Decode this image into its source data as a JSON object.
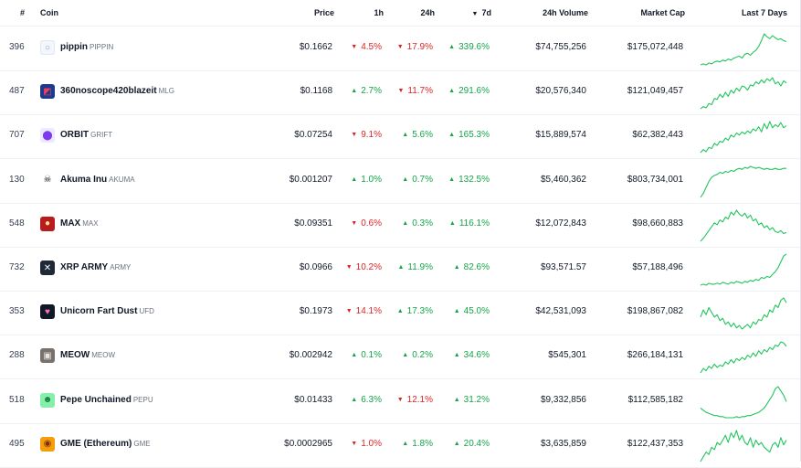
{
  "header": {
    "rank": "#",
    "coin": "Coin",
    "price": "Price",
    "h1": "1h",
    "h24": "24h",
    "d7": "7d",
    "volume": "24h Volume",
    "market_cap": "Market Cap",
    "last7": "Last 7 Days",
    "sort_indicator": "▼"
  },
  "colors": {
    "positive": "#16a34a",
    "negative": "#dc2626",
    "sparkline": "#22c55e"
  },
  "rows": [
    {
      "rank": "396",
      "name": "pippin",
      "symbol": "PIPPIN",
      "icon": "pippin-icon",
      "price": "$0.1662",
      "h1": "4.5%",
      "h1_dir": "down",
      "h24": "17.9%",
      "h24_dir": "down",
      "d7": "339.6%",
      "d7_dir": "up",
      "volume": "$74,755,256",
      "market_cap": "$175,072,448",
      "spark": [
        3,
        4,
        3,
        5,
        4,
        6,
        7,
        6,
        8,
        7,
        9,
        8,
        10,
        11,
        12,
        10,
        14,
        15,
        13,
        16,
        18,
        22,
        28,
        35,
        32,
        30,
        33,
        31,
        29,
        30,
        28,
        27
      ]
    },
    {
      "rank": "487",
      "name": "360noscope420blazeit",
      "symbol": "MLG",
      "icon": "mlg-icon",
      "price": "$0.1168",
      "h1": "2.7%",
      "h1_dir": "up",
      "h24": "11.7%",
      "h24_dir": "down",
      "d7": "291.6%",
      "d7_dir": "up",
      "volume": "$20,576,340",
      "market_cap": "$121,049,457",
      "spark": [
        4,
        6,
        5,
        9,
        8,
        14,
        13,
        18,
        15,
        20,
        16,
        22,
        19,
        24,
        21,
        26,
        25,
        22,
        27,
        26,
        30,
        28,
        32,
        29,
        33,
        31,
        34,
        28,
        30,
        26,
        31,
        29
      ]
    },
    {
      "rank": "707",
      "name": "ORBIT",
      "symbol": "GRIFT",
      "icon": "orbit-icon",
      "price": "$0.07254",
      "h1": "9.1%",
      "h1_dir": "down",
      "h24": "5.6%",
      "h24_dir": "up",
      "d7": "165.3%",
      "d7_dir": "up",
      "volume": "$15,889,574",
      "market_cap": "$62,382,443",
      "spark": [
        5,
        8,
        6,
        10,
        9,
        14,
        12,
        16,
        15,
        19,
        17,
        22,
        20,
        24,
        22,
        25,
        23,
        26,
        24,
        28,
        26,
        30,
        25,
        33,
        28,
        35,
        29,
        32,
        30,
        34,
        29,
        31
      ]
    },
    {
      "rank": "130",
      "name": "Akuma Inu",
      "symbol": "AKUMA",
      "icon": "akuma-icon",
      "price": "$0.001207",
      "h1": "1.0%",
      "h1_dir": "up",
      "h24": "0.7%",
      "h24_dir": "up",
      "d7": "132.5%",
      "d7_dir": "up",
      "volume": "$5,460,362",
      "market_cap": "$803,734,001",
      "spark": [
        2,
        6,
        12,
        18,
        22,
        24,
        25,
        27,
        26,
        28,
        27,
        29,
        28,
        30,
        31,
        30,
        32,
        31,
        33,
        32,
        31,
        32,
        31,
        30,
        31,
        30,
        30,
        31,
        30,
        30,
        31,
        31
      ]
    },
    {
      "rank": "548",
      "name": "MAX",
      "symbol": "MAX",
      "icon": "max-icon",
      "price": "$0.09351",
      "h1": "0.6%",
      "h1_dir": "down",
      "h24": "0.3%",
      "h24_dir": "up",
      "d7": "116.1%",
      "d7_dir": "up",
      "volume": "$12,072,843",
      "market_cap": "$98,660,883",
      "spark": [
        3,
        6,
        10,
        14,
        18,
        22,
        20,
        25,
        23,
        28,
        26,
        33,
        30,
        35,
        31,
        29,
        32,
        27,
        30,
        24,
        26,
        20,
        22,
        17,
        19,
        15,
        17,
        13,
        12,
        14,
        11,
        12
      ]
    },
    {
      "rank": "732",
      "name": "XRP ARMY",
      "symbol": "ARMY",
      "icon": "army-icon",
      "price": "$0.0966",
      "h1": "10.2%",
      "h1_dir": "down",
      "h24": "11.9%",
      "h24_dir": "up",
      "d7": "82.6%",
      "d7_dir": "up",
      "volume": "$93,571.57",
      "market_cap": "$57,188,496",
      "spark": [
        4,
        5,
        4,
        6,
        5,
        5,
        6,
        5,
        7,
        6,
        5,
        7,
        6,
        8,
        7,
        6,
        8,
        7,
        9,
        8,
        10,
        9,
        12,
        11,
        13,
        12,
        15,
        18,
        22,
        28,
        34,
        36
      ]
    },
    {
      "rank": "353",
      "name": "Unicorn Fart Dust",
      "symbol": "UFD",
      "icon": "ufd-icon",
      "price": "$0.1973",
      "h1": "14.1%",
      "h1_dir": "down",
      "h24": "17.3%",
      "h24_dir": "up",
      "d7": "45.0%",
      "d7_dir": "up",
      "volume": "$42,531,093",
      "market_cap": "$198,867,082",
      "spark": [
        18,
        24,
        20,
        26,
        22,
        18,
        20,
        15,
        17,
        12,
        14,
        10,
        13,
        9,
        11,
        8,
        10,
        12,
        9,
        14,
        12,
        16,
        15,
        20,
        18,
        24,
        22,
        28,
        26,
        32,
        34,
        30
      ]
    },
    {
      "rank": "288",
      "name": "MEOW",
      "symbol": "MEOW",
      "icon": "meow-icon",
      "price": "$0.002942",
      "h1": "0.1%",
      "h1_dir": "up",
      "h24": "0.2%",
      "h24_dir": "up",
      "d7": "34.6%",
      "d7_dir": "up",
      "volume": "$545,301",
      "market_cap": "$266,184,131",
      "spark": [
        6,
        10,
        8,
        12,
        10,
        14,
        11,
        13,
        12,
        16,
        14,
        18,
        15,
        19,
        17,
        20,
        18,
        22,
        20,
        24,
        21,
        26,
        23,
        27,
        25,
        29,
        27,
        31,
        30,
        34,
        33,
        30
      ]
    },
    {
      "rank": "518",
      "name": "Pepe Unchained",
      "symbol": "PEPU",
      "icon": "pepu-icon",
      "price": "$0.01433",
      "h1": "6.3%",
      "h1_dir": "up",
      "h24": "12.1%",
      "h24_dir": "down",
      "d7": "31.2%",
      "d7_dir": "up",
      "volume": "$9,332,856",
      "market_cap": "$112,585,182",
      "spark": [
        14,
        12,
        10,
        9,
        8,
        7,
        7,
        6,
        6,
        5,
        5,
        5,
        5,
        6,
        5,
        6,
        6,
        7,
        7,
        8,
        9,
        10,
        12,
        14,
        18,
        22,
        26,
        32,
        34,
        30,
        26,
        20
      ]
    },
    {
      "rank": "495",
      "name": "GME (Ethereum)",
      "symbol": "GME",
      "icon": "gme-icon",
      "price": "$0.0002965",
      "h1": "1.0%",
      "h1_dir": "down",
      "h24": "1.8%",
      "h24_dir": "up",
      "d7": "20.4%",
      "d7_dir": "up",
      "volume": "$3,635,859",
      "market_cap": "$122,437,353",
      "spark": [
        6,
        10,
        14,
        12,
        18,
        16,
        22,
        20,
        24,
        28,
        22,
        30,
        26,
        32,
        24,
        28,
        22,
        20,
        26,
        18,
        24,
        20,
        22,
        18,
        16,
        14,
        20,
        22,
        18,
        26,
        20,
        24
      ]
    }
  ]
}
